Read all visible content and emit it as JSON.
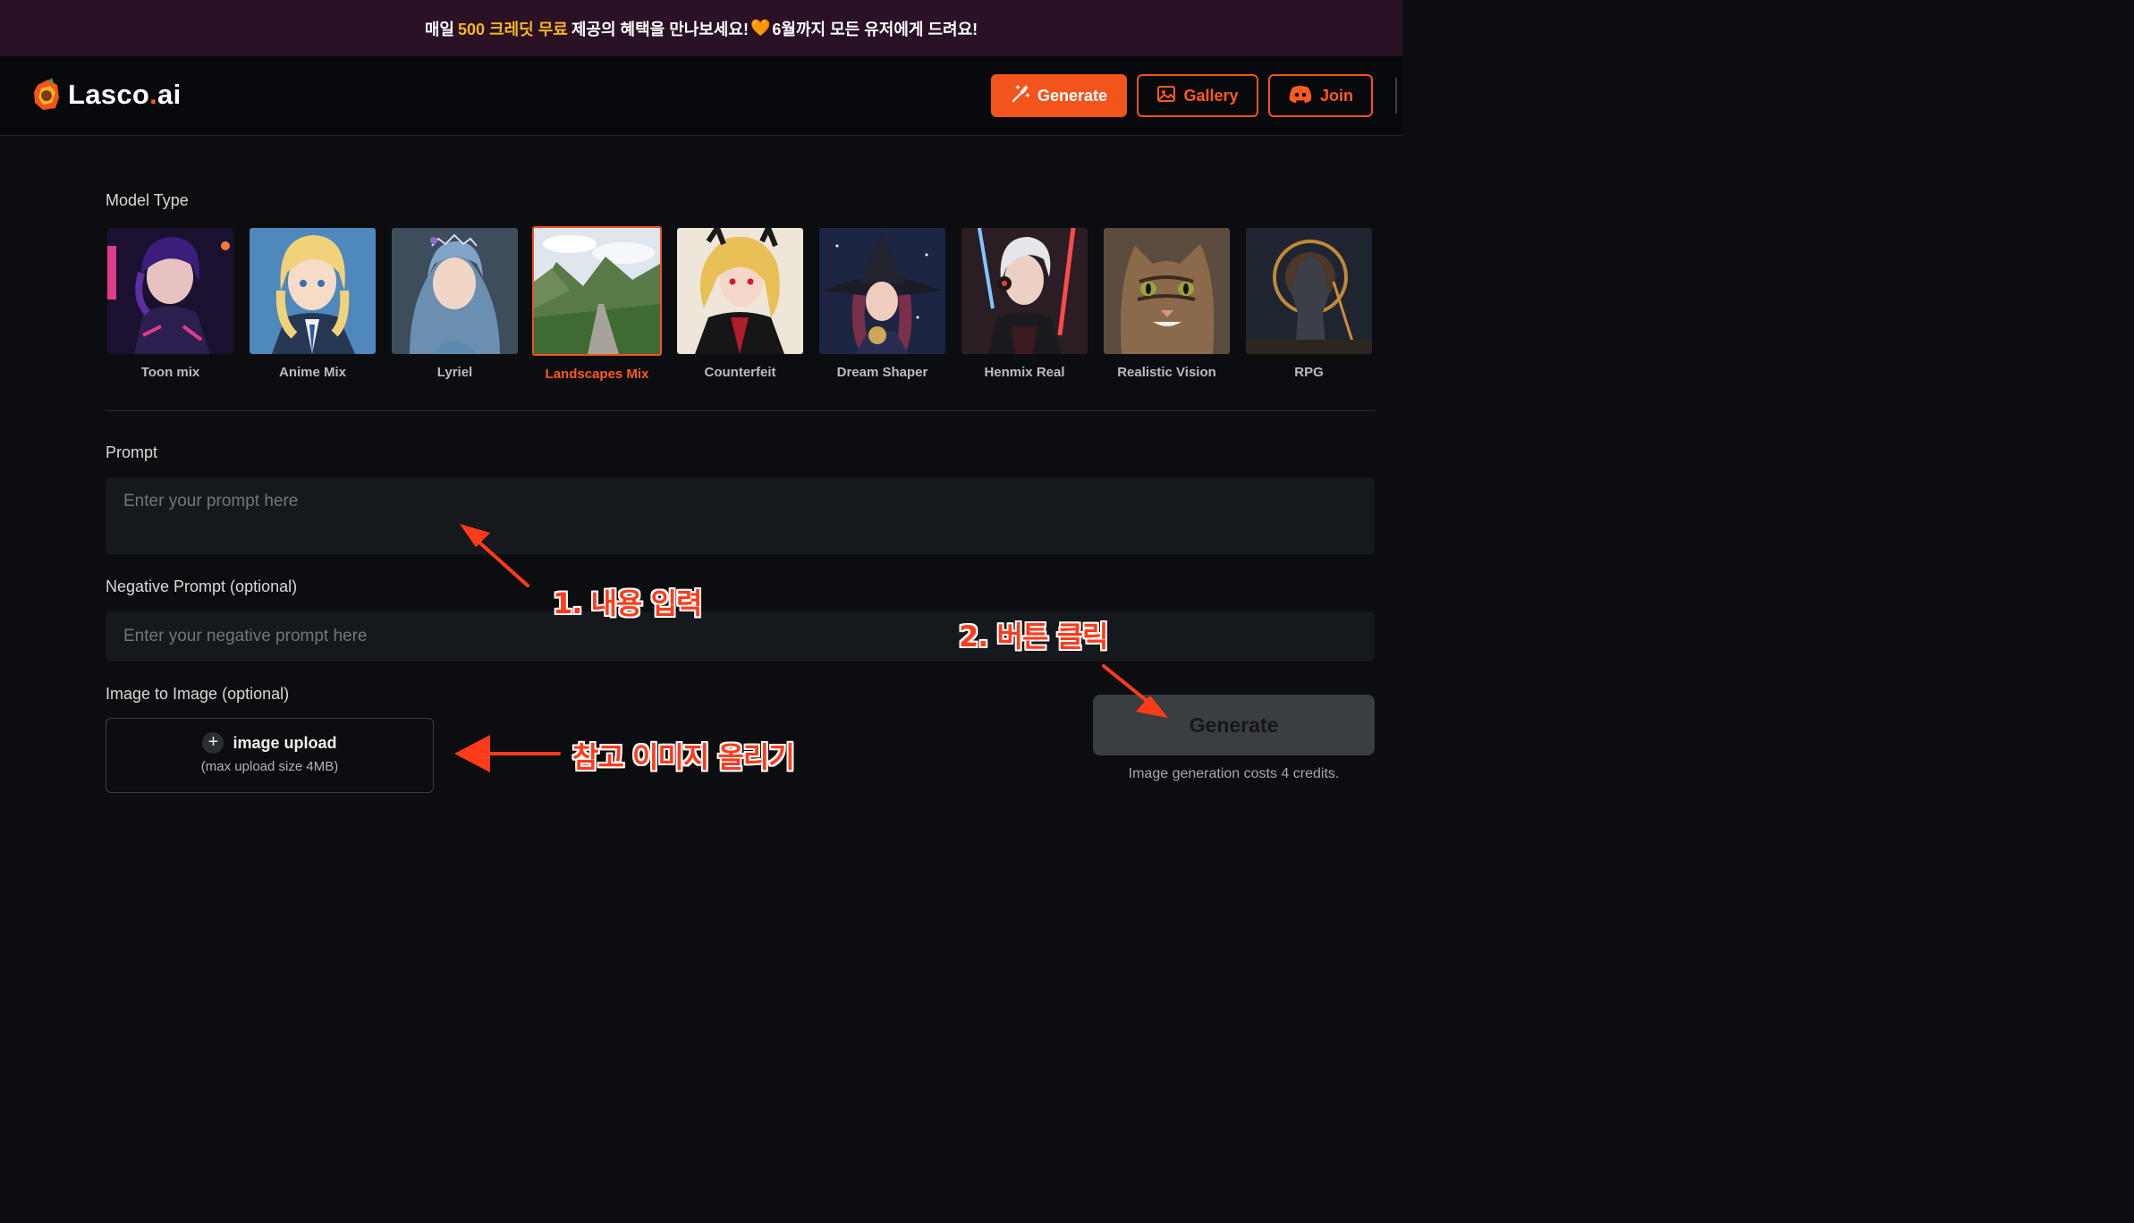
{
  "banner": {
    "text_a": "매일",
    "highlight": "500 크레딧 무료",
    "text_b": "제공의 혜택을 만나보세요!",
    "heart": "🧡",
    "text_c": "6월까지 모든 유저에게 드려요!"
  },
  "header": {
    "logo_text": "Lasco",
    "logo_dot": ".",
    "logo_suffix": "ai",
    "nav": {
      "generate": "Generate",
      "gallery": "Gallery",
      "join": "Join"
    }
  },
  "model_section": {
    "label": "Model Type",
    "selected": "Landscapes Mix",
    "models": [
      {
        "name": "Toon mix",
        "thumb_color": "#3a1f57"
      },
      {
        "name": "Anime Mix",
        "thumb_color": "#4f88bd"
      },
      {
        "name": "Lyriel",
        "thumb_color": "#47627a"
      },
      {
        "name": "Landscapes Mix",
        "thumb_color": "#5e7a4c"
      },
      {
        "name": "Counterfeit",
        "thumb_color": "#e9dccb"
      },
      {
        "name": "Dream Shaper",
        "thumb_color": "#202c4a"
      },
      {
        "name": "Henmix Real",
        "thumb_color": "#5a2b33"
      },
      {
        "name": "Realistic Vision",
        "thumb_color": "#6b5a48"
      },
      {
        "name": "RPG",
        "thumb_color": "#2f3a45"
      }
    ]
  },
  "prompt": {
    "label": "Prompt",
    "placeholder": "Enter your prompt here"
  },
  "negative_prompt": {
    "label": "Negative Prompt (optional)",
    "placeholder": "Enter your negative prompt here"
  },
  "img2img": {
    "label": "Image to Image (optional)",
    "upload_label": "image upload",
    "upload_note": "(max upload size 4MB)"
  },
  "generate": {
    "button_label": "Generate",
    "credits_note": "Image generation costs 4 credits."
  },
  "annotations": {
    "step1": "1. 내용 입력",
    "step2": "2. 버튼 클릭",
    "upload_hint": "참고 이미지 올리기"
  },
  "colors": {
    "accent": "#f2541b",
    "banner_bg": "#2a1126",
    "page_bg": "#0b0d10",
    "field_bg": "#15181d",
    "annotation": "#ff3b1a",
    "highlight": "#f5b524"
  }
}
